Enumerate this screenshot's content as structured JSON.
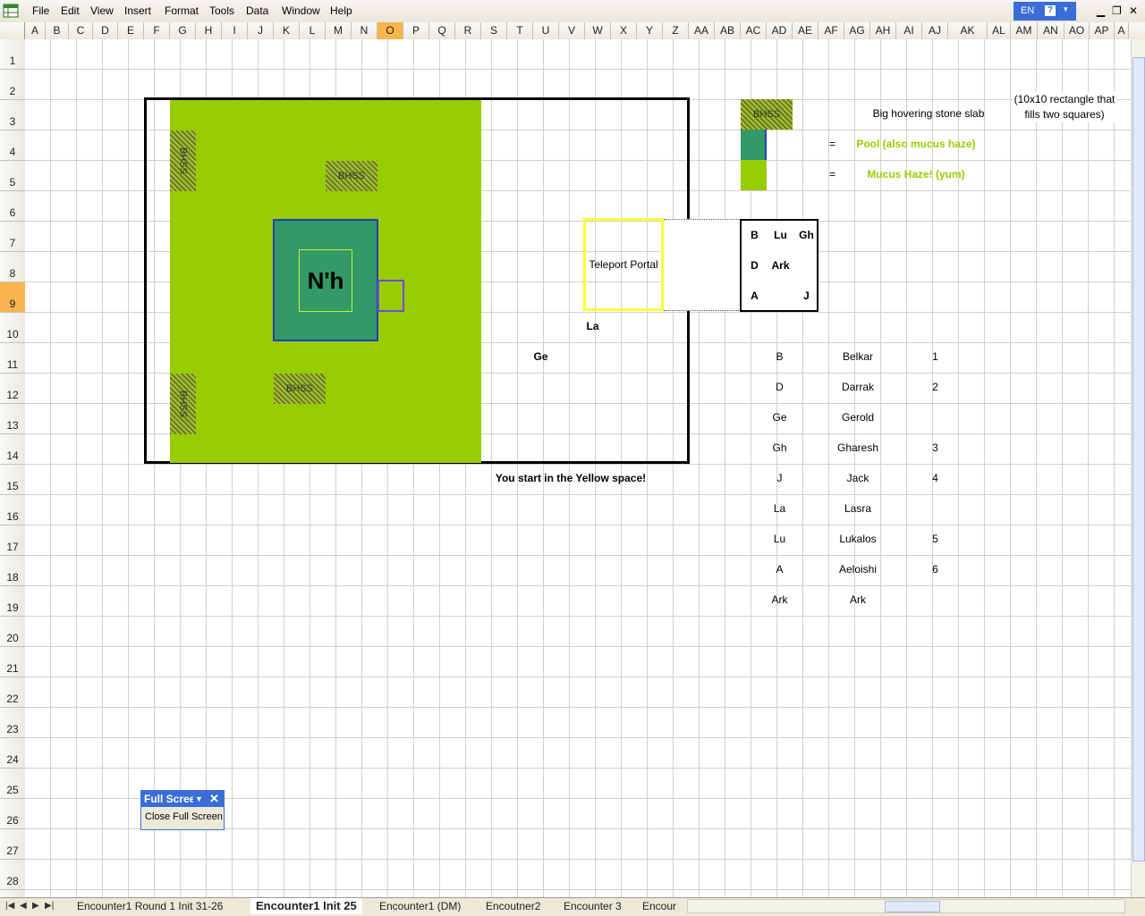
{
  "menu": [
    "File",
    "Edit",
    "View",
    "Insert",
    "Format",
    "Tools",
    "Data",
    "Window",
    "Help"
  ],
  "language": "EN",
  "help_glyph": "?",
  "columns": [
    "A",
    "B",
    "C",
    "D",
    "E",
    "F",
    "G",
    "H",
    "I",
    "J",
    "K",
    "L",
    "M",
    "N",
    "O",
    "P",
    "Q",
    "R",
    "S",
    "T",
    "U",
    "V",
    "W",
    "X",
    "Y",
    "Z",
    "AA",
    "AB",
    "AC",
    "AD",
    "AE",
    "AF",
    "AG",
    "AH",
    "AI",
    "AJ",
    "AK",
    "AL",
    "AM",
    "AN",
    "AO",
    "AP",
    "A"
  ],
  "active_column": "O",
  "rows": [
    "1",
    "2",
    "3",
    "4",
    "5",
    "6",
    "7",
    "8",
    "9",
    "10",
    "11",
    "12",
    "13",
    "14",
    "15",
    "16",
    "17",
    "18",
    "19",
    "20",
    "21",
    "22",
    "23",
    "24",
    "25",
    "26",
    "27",
    "28"
  ],
  "active_row": "9",
  "map": {
    "boss_label": "N'h",
    "slab_label": "BHSS",
    "portal_label": "Teleport Portal",
    "start_note": "You start in the Yellow space!",
    "tokens": {
      "la": "La",
      "ge": "Ge"
    }
  },
  "legend": {
    "slab_symbol": "BHSS",
    "slab_desc": "Big hovering stone slab",
    "pool_eq": "=",
    "pool_desc": "Pool (also mucus haze)",
    "haze_eq": "=",
    "haze_desc": "Mucus Haze! (yum)",
    "note": "(10x10 rectangle that fills two squares)"
  },
  "formation": [
    "B",
    "Lu",
    "Gh",
    "D",
    "Ark",
    "",
    "A",
    "",
    "J"
  ],
  "roster": [
    {
      "abbr": "B",
      "name": "Belkar",
      "order": "1"
    },
    {
      "abbr": "D",
      "name": "Darrak",
      "order": "2"
    },
    {
      "abbr": "Ge",
      "name": "Gerold",
      "order": ""
    },
    {
      "abbr": "Gh",
      "name": "Gharesh",
      "order": "3"
    },
    {
      "abbr": "J",
      "name": "Jack",
      "order": "4"
    },
    {
      "abbr": "La",
      "name": "Lasra",
      "order": ""
    },
    {
      "abbr": "Lu",
      "name": "Lukalos",
      "order": "5"
    },
    {
      "abbr": "A",
      "name": "Aeloishi",
      "order": "6"
    },
    {
      "abbr": "Ark",
      "name": "Ark",
      "order": ""
    }
  ],
  "toolbar": {
    "title": "Full Screen",
    "close_label": "Close Full Screen"
  },
  "tabs": [
    "Encounter1  Round 1 Init 31-26",
    "Encounter1  Init 25",
    "Encounter1  (DM)",
    "Encoutner2",
    "Encounter 3",
    "Encour"
  ],
  "active_tab": 1,
  "colors": {
    "haze": "#99cc00",
    "pool": "#339966",
    "portal": "#ffff33",
    "accent": "#3a6ed6"
  }
}
